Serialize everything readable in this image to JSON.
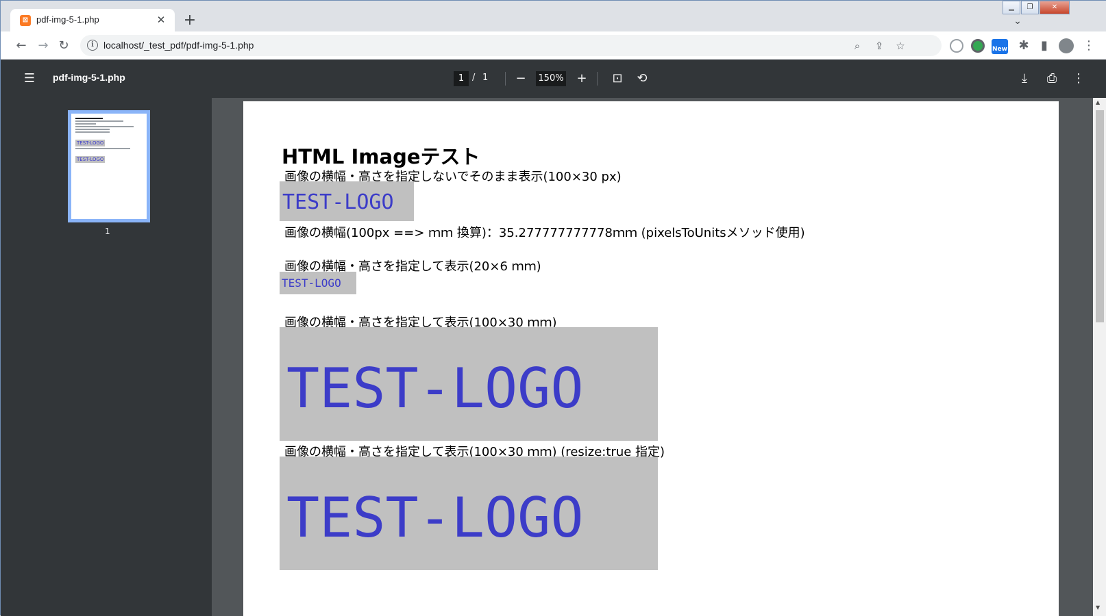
{
  "browser": {
    "tab_title": "pdf-img-5-1.php",
    "tab_favicon": "xampp-icon",
    "url": "localhost/_test_pdf/pdf-img-5-1.php",
    "ext_new_badge": "New"
  },
  "pdf_viewer": {
    "title": "pdf-img-5-1.php",
    "current_page": "1",
    "page_separator": "/",
    "total_pages": "1",
    "zoom": "150%",
    "thumbnail_number": "1"
  },
  "document": {
    "heading": "HTML Imageテスト",
    "line1": "画像の横幅・高さを指定しないでそのまま表示(100×30 px)",
    "logo1": "TEST-LOGO",
    "line2": "画像の横幅(100px ==> ｍｍ 換算)：35.277777777778ｍｍ (pixelsToUnitsメソッド使用)",
    "line3": "画像の横幅・高さを指定して表示(20×6 ｍｍ)",
    "logo2": "TEST-LOGO",
    "line4": "画像の横幅・高さを指定して表示(100×30 ｍｍ)",
    "logo3": "TEST-LOGO",
    "line5": "画像の横幅・高さを指定して表示(100×30 ｍｍ) (resize:true 指定)",
    "logo4": "TEST-LOGO"
  },
  "colors": {
    "logo_bg": "#c0c0c0",
    "logo_text": "#3c3cc8",
    "viewer_bar": "#323639",
    "viewer_bg": "#525659"
  }
}
